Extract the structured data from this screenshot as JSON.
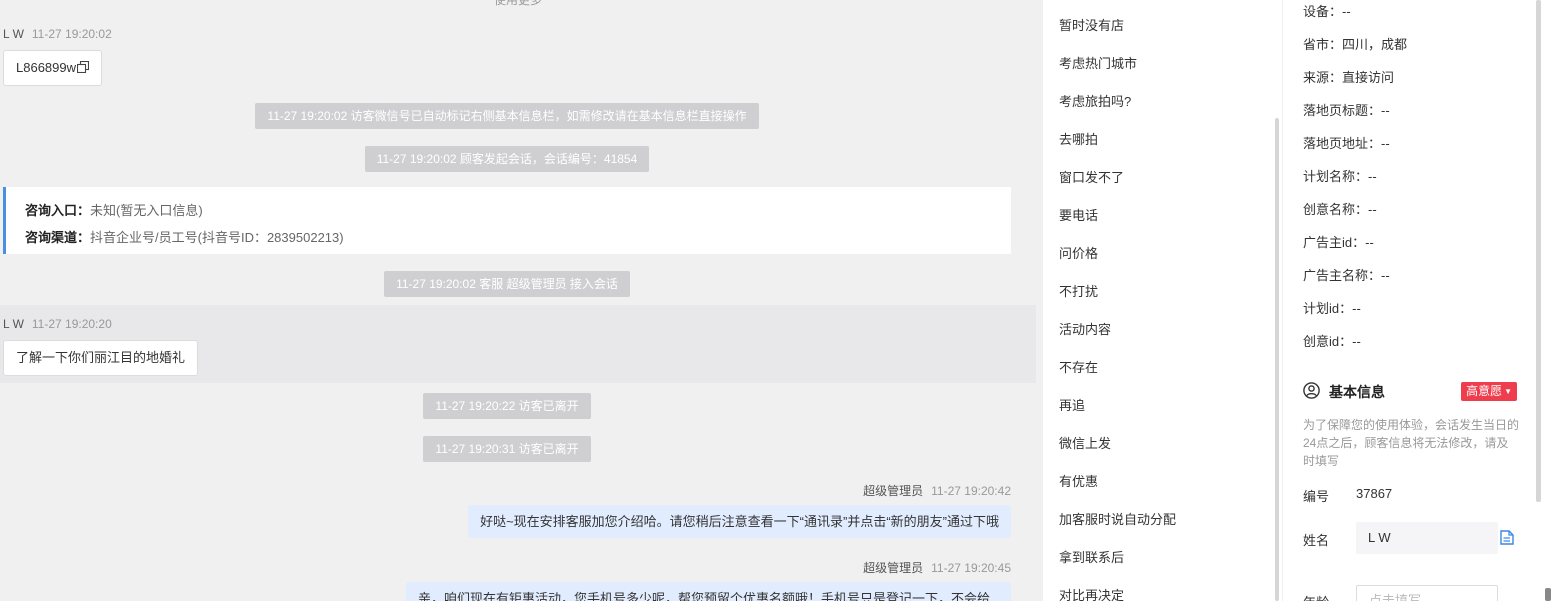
{
  "chat": {
    "top_hint": "使用更多",
    "messages": [
      {
        "sender": "L W",
        "time": "11-27 19:20:02",
        "text": "L866899w"
      },
      {
        "sender": "L W",
        "time": "11-27 19:20:20",
        "text": "了解一下你们丽江目的地婚礼"
      }
    ],
    "system": [
      "11-27 19:20:02 访客微信号已自动标记右侧基本信息栏，如需修改请在基本信息栏直接操作",
      "11-27 19:20:02 顾客发起会话，会话编号：41854",
      "11-27 19:20:02 客服 超级管理员 接入会话",
      "11-27 19:20:22 访客已离开",
      "11-27 19:20:31 访客已离开"
    ],
    "entry": {
      "entry_label": "咨询入口：",
      "entry_value": "未知(暂无入口信息)",
      "channel_label": "咨询渠道：",
      "channel_value": "抖音企业号/员工号(抖音号ID：2839502213)"
    },
    "agent_messages": [
      {
        "sender": "超级管理员",
        "time": "11-27 19:20:42",
        "text": "好哒~现在安排客服加您介绍哈。请您稍后注意查看一下“通讯录”并点击“新的朋友”通过下哦"
      },
      {
        "sender": "超级管理员",
        "time": "11-27 19:20:45",
        "text": "亲，咱们现在有钜惠活动，您手机号多少呢，帮您预留个优惠名额哦！手机号只是登记一下，不会给"
      }
    ]
  },
  "quick_replies": [
    "暂时没有店",
    "考虑热门城市",
    "考虑旅拍吗?",
    "去哪拍",
    "窗口发不了",
    "要电话",
    "问价格",
    "不打扰",
    "活动内容",
    "不存在",
    "再追",
    "微信上发",
    "有优惠",
    "加客服时说自动分配",
    "拿到联系后",
    "对比再决定"
  ],
  "info": {
    "rows": [
      {
        "label": "设备：",
        "value": "--"
      },
      {
        "label": "省市：",
        "value": "四川，成都"
      },
      {
        "label": "来源：",
        "value": "直接访问"
      },
      {
        "label": "落地页标题：",
        "value": "--"
      },
      {
        "label": "落地页地址：",
        "value": "--"
      },
      {
        "label": "计划名称：",
        "value": "--"
      },
      {
        "label": "创意名称：",
        "value": "--"
      },
      {
        "label": "广告主id：",
        "value": "--"
      },
      {
        "label": "广告主名称：",
        "value": "--"
      },
      {
        "label": "计划id：",
        "value": "--"
      },
      {
        "label": "创意id：",
        "value": "--"
      }
    ],
    "basic": {
      "title": "基本信息",
      "intent": "高意愿",
      "notice": "为了保障您的使用体验，会话发生当日的24点之后，顾客信息将无法修改，请及时填写",
      "id_label": "编号",
      "id_value": "37867",
      "name_label": "姓名",
      "name_value": "L W",
      "age_label": "年龄",
      "age_placeholder": "点击填写"
    }
  },
  "colors": {
    "accent_blue": "#4a90e2",
    "intent_red": "#ee3e4d",
    "agent_bubble": "#e1edff",
    "system_badge": "#cfcfd1"
  }
}
